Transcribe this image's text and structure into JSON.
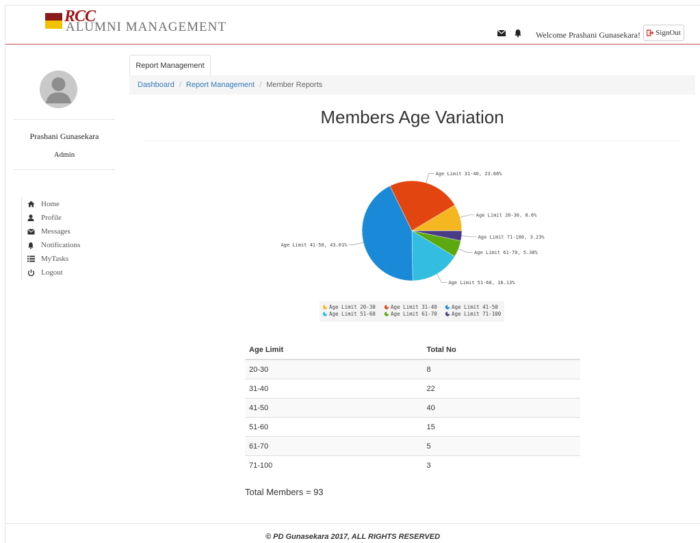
{
  "header": {
    "logo_script": "RCC",
    "logo_text": "ALUMNI MANAGEMENT",
    "welcome": "Welcome Prashani Gunasekara!",
    "signout_label": "SignOut",
    "icons": [
      "envelope-icon",
      "bell-icon",
      "signout-icon"
    ]
  },
  "sidebar": {
    "user_name": "Prashani Gunasekara",
    "user_role": "Admin",
    "items": [
      {
        "label": "Home",
        "icon": "home-icon"
      },
      {
        "label": "Profile",
        "icon": "user-icon"
      },
      {
        "label": "Messages",
        "icon": "envelope-icon"
      },
      {
        "label": "Notifications",
        "icon": "bell-icon"
      },
      {
        "label": "MyTasks",
        "icon": "list-icon"
      },
      {
        "label": "Logout",
        "icon": "power-icon"
      }
    ]
  },
  "tabs": [
    {
      "label": "Report Management"
    }
  ],
  "breadcrumb": {
    "items": [
      "Dashboard",
      "Report Management",
      "Member Reports"
    ]
  },
  "page": {
    "title": "Members Age Variation",
    "total_label": "Total Members = 93"
  },
  "chart_data": {
    "type": "pie",
    "slices": [
      {
        "name": "Age Limit 20-30",
        "value": 8.6,
        "label": "Age Limit 20-30, 8.6%",
        "color": "#f5b720"
      },
      {
        "name": "Age Limit 31-40",
        "value": 23.66,
        "label": "Age Limit 31-40, 23.66%",
        "color": "#e2450f"
      },
      {
        "name": "Age Limit 41-50",
        "value": 43.01,
        "label": "Age Limit 41-50, 43.01%",
        "color": "#1a8ad8"
      },
      {
        "name": "Age Limit 51-60",
        "value": 16.13,
        "label": "Age Limit 51-60, 16.13%",
        "color": "#33bde0"
      },
      {
        "name": "Age Limit 61-70",
        "value": 5.38,
        "label": "Age Limit 61-70, 5.38%",
        "color": "#5ea80f"
      },
      {
        "name": "Age Limit 71-100",
        "value": 3.23,
        "label": "Age Limit 71-100, 3.23%",
        "color": "#4a3c84"
      }
    ],
    "legend_placement": "bottom"
  },
  "table": {
    "headers": [
      "Age Limit",
      "Total No"
    ],
    "rows": [
      [
        "20-30",
        "8"
      ],
      [
        "31-40",
        "22"
      ],
      [
        "41-50",
        "40"
      ],
      [
        "51-60",
        "15"
      ],
      [
        "61-70",
        "5"
      ],
      [
        "71-100",
        "3"
      ]
    ]
  },
  "footer": {
    "text": "© PD Gunasekara 2017, ALL RIGHTS RESERVED"
  },
  "colors": {
    "brand_red": "#8b1a1a",
    "brand_yellow": "#f2c200",
    "link": "#337ab7",
    "header_line": "#c0504d"
  }
}
